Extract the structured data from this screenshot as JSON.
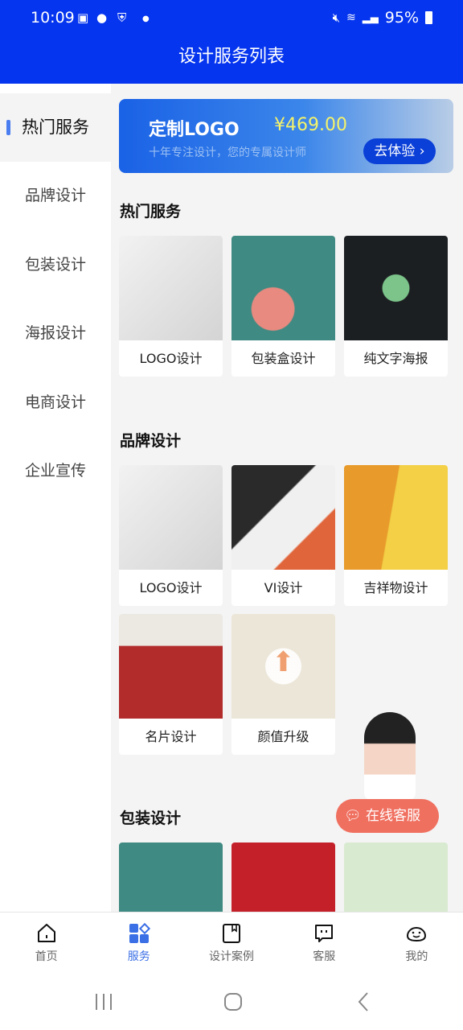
{
  "status": {
    "time": "10:09",
    "battery": "95%"
  },
  "header": {
    "title": "设计服务列表"
  },
  "sidebar": {
    "items": [
      {
        "label": "热门服务",
        "active": true
      },
      {
        "label": "品牌设计"
      },
      {
        "label": "包装设计"
      },
      {
        "label": "海报设计"
      },
      {
        "label": "电商设计"
      },
      {
        "label": "企业宣传"
      }
    ]
  },
  "banner": {
    "title": "定制LOGO",
    "price": "¥469.00",
    "subtitle": "十年专注设计，您的专属设计师",
    "button": "去体验 ›"
  },
  "sections": [
    {
      "title": "热门服务",
      "items": [
        {
          "label": "LOGO设计"
        },
        {
          "label": "包装盒设计"
        },
        {
          "label": "纯文字海报"
        }
      ]
    },
    {
      "title": "品牌设计",
      "items": [
        {
          "label": "LOGO设计"
        },
        {
          "label": "VI设计"
        },
        {
          "label": "吉祥物设计"
        },
        {
          "label": "名片设计"
        },
        {
          "label": "颜值升级"
        }
      ]
    },
    {
      "title": "包装设计",
      "items": []
    }
  ],
  "float_service": {
    "label": "在线客服"
  },
  "bottom_nav": [
    {
      "label": "首页"
    },
    {
      "label": "服务",
      "active": true
    },
    {
      "label": "设计案例"
    },
    {
      "label": "客服"
    },
    {
      "label": "我的"
    }
  ],
  "colors": {
    "primary": "#0535ef",
    "accent": "#3b6fe6",
    "price": "#f5f36a",
    "service_button": "#f07060"
  }
}
